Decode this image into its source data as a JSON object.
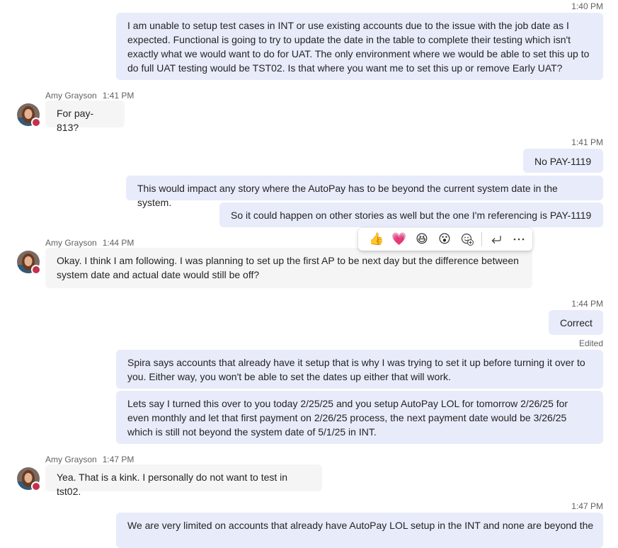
{
  "messages": {
    "m1": {
      "time": "1:40 PM",
      "text": "I am unable to setup test cases in INT or use existing accounts due to the issue with the job date as I expected. Functional is going to try to update the date in the table to complete their testing which isn't exactly what we would want to do for UAT. The only environment where we would be able to set this up to do full UAT testing would be TST02. Is that where you want me to set this up or remove Early UAT?"
    },
    "m2": {
      "sender": "Amy Grayson",
      "time": "1:41 PM",
      "text": "For pay-813?"
    },
    "m3": {
      "time": "1:41 PM",
      "text": "No PAY-1119"
    },
    "m4": {
      "text": "This would impact any story where the AutoPay has to be beyond the current system date in the system."
    },
    "m5": {
      "text": "So it could happen on other stories as well but the one I'm referencing is PAY-1119"
    },
    "m6": {
      "sender": "Amy Grayson",
      "time": "1:44 PM",
      "text": "Okay. I think I am following. I was planning to set up the first AP to be next day but the difference between system date and actual date would still be off?"
    },
    "m7": {
      "time": "1:44 PM",
      "text": "Correct"
    },
    "m8": {
      "edited": "Edited",
      "text": "Spira says accounts that already have it setup that is why I was trying to set it up before turning it over to you. Either way, you won't be able to set the dates up either that will work."
    },
    "m9": {
      "text": "Lets say I turned this over to you today 2/25/25 and you setup AutoPay LOL for tomorrow 2/26/25 for even monthly and let that first payment on 2/26/25 process, the next payment date would be 3/26/25 which is still not beyond the system date of 5/1/25 in INT."
    },
    "m10": {
      "sender": "Amy Grayson",
      "time": "1:47 PM",
      "text": "Yea. That is a kink. I personally do not want to test in tst02."
    },
    "m11": {
      "time": "1:47 PM",
      "text": "We are very limited on accounts that already have AutoPay LOL setup in the INT and none are beyond the"
    }
  },
  "reactions": {
    "like": "👍",
    "heart": "💗",
    "laugh": "😆",
    "surprised": "😮",
    "add_reaction_icon": "add-reaction-icon",
    "reply_icon": "reply-icon",
    "more_icon": "more-options-icon"
  },
  "colors": {
    "my_bubble": "#e8ebfa",
    "their_bubble": "#f5f5f5",
    "presence_busy": "#c4314b"
  }
}
